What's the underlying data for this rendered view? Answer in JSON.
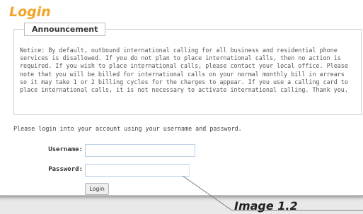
{
  "header": {
    "title": "Login"
  },
  "announcement": {
    "heading": "Announcement",
    "lines": [
      "Notice: By default, outbound international calling for all business and residential phone",
      "services is disallowed. If you do not plan to place international calls, then no action is",
      "required. If you wish to place international calls, please contact your local office. Please",
      "note that you will be billed for international calls on your normal monthly bill in arrears",
      "so it may take 1 or 2 billing cycles for the charges to appear. If you use a calling card to",
      "place international calls, it is not necessary to activate international calling. Thank you."
    ]
  },
  "login": {
    "intro": "Please login into your account using your username and password.",
    "username_label": "Username:",
    "username_value": "",
    "password_label": "Password:",
    "password_value": "",
    "submit_label": "Login"
  },
  "caption": "Image 1.2",
  "colors": {
    "title": "#f2a427",
    "input_border": "#b9cfe6",
    "page_bg": "#e9e9e9"
  }
}
